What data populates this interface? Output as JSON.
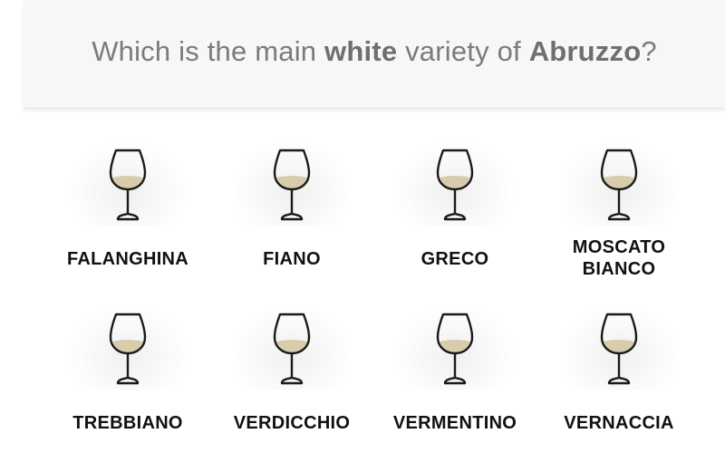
{
  "question": {
    "prefix": "Which is the main ",
    "highlight_color": "white",
    "middle": " variety of ",
    "highlight_region": "Abruzzo",
    "suffix": "?"
  },
  "options": [
    {
      "label_line1": "FALANGHINA",
      "label_line2": ""
    },
    {
      "label_line1": "FIANO",
      "label_line2": ""
    },
    {
      "label_line1": "GRECO",
      "label_line2": ""
    },
    {
      "label_line1": "MOSCATO",
      "label_line2": "BIANCO"
    },
    {
      "label_line1": "TREBBIANO",
      "label_line2": ""
    },
    {
      "label_line1": "VERDICCHIO",
      "label_line2": ""
    },
    {
      "label_line1": "VERMENTINO",
      "label_line2": ""
    },
    {
      "label_line1": "VERNACCIA",
      "label_line2": ""
    }
  ],
  "colors": {
    "wine_fill": "#d8ccac",
    "glass_stroke": "#1a1a1a",
    "question_text": "#7b7b7b",
    "label_text": "#111111"
  },
  "icons": {
    "option_icon": "white-wine-glass-icon"
  }
}
